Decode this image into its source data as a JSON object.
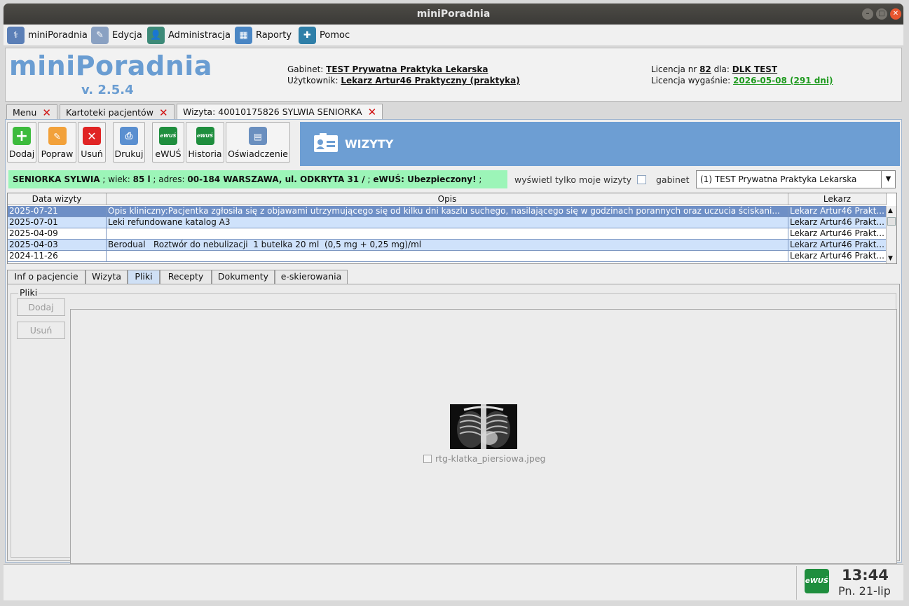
{
  "window": {
    "title": "miniPoradnia"
  },
  "menu": [
    {
      "label": "miniPoradnia",
      "icon": "doctor-icon",
      "color": "#5b7fb7"
    },
    {
      "label": "Edycja",
      "icon": "edit-icon",
      "color": "#8aa1c2"
    },
    {
      "label": "Administracja",
      "icon": "admin-user-icon",
      "color": "#3d8a78"
    },
    {
      "label": "Raporty",
      "icon": "report-icon",
      "color": "#4a86c4"
    },
    {
      "label": "Pomoc",
      "icon": "help-lifebuoy-icon",
      "color": "#2f7fa8"
    }
  ],
  "header": {
    "logo": "miniPoradnia",
    "version": "v. 2.5.4",
    "gabinet_label": "Gabinet:",
    "gabinet_value": "TEST Prywatna Praktyka Lekarska",
    "user_label": "Użytkownik:",
    "user_value": "Lekarz Artur46 Praktyczny (praktyka)",
    "license_label": "Licencja nr",
    "license_nr": "82",
    "license_for": "dla:",
    "license_owner": "DLK TEST",
    "expiry_label": "Licencja wygaśnie:",
    "expiry_value": "2026-05-08 (291 dni)"
  },
  "doc_tabs": [
    {
      "label": "Menu"
    },
    {
      "label": "Kartoteki pacjentów"
    },
    {
      "label": "Wizyta: 40010175826 SYLWIA SENIORKA"
    }
  ],
  "toolbar": {
    "add": "Dodaj",
    "edit": "Popraw",
    "delete": "Usuń",
    "print": "Drukuj",
    "ewus": "eWUŚ",
    "history": "Historia",
    "statement": "Oświadczenie",
    "ewus_badge": "eWUŚ",
    "banner_title": "WIZYTY"
  },
  "patient": {
    "name": "SENIORKA SYLWIA",
    "sep1": " ; wiek: ",
    "age": "85 l",
    "sep2": " ; adres: ",
    "address": "00-184 WARSZAWA, ul. ODKRYTA 31 /",
    "sep3": " ; ",
    "ewus": "eWUŚ: Ubezpieczony!",
    "sep4": " ;"
  },
  "filter": {
    "only_mine_label": "wyświetl tylko moje wizyty",
    "gabinet_label": "gabinet",
    "gabinet_selected": "(1) TEST Prywatna Praktyka Lekarska"
  },
  "visits": {
    "columns": [
      "Data wizyty",
      "Opis",
      "Lekarz"
    ],
    "rows": [
      {
        "date": "2025-07-21",
        "desc": "Opis kliniczny:Pacjentka zgłosiła się z objawami utrzymującego się od kilku dni kaszlu suchego, nasilającego się w godzinach porannych oraz uczucia ściskani...",
        "doctor": "Lekarz Artur46 Prakt..."
      },
      {
        "date": "2025-07-01",
        "desc": "Leki refundowane katalog A3",
        "doctor": "Lekarz Artur46 Prakt..."
      },
      {
        "date": "2025-04-09",
        "desc": "",
        "doctor": "Lekarz Artur46 Prakt..."
      },
      {
        "date": "2025-04-03",
        "desc": "Berodual   Roztwór do nebulizacji  1 butelka 20 ml  (0,5 mg + 0,25 mg)/ml",
        "doctor": "Lekarz Artur46 Prakt..."
      },
      {
        "date": "2024-11-26",
        "desc": "",
        "doctor": "Lekarz Artur46 Prakt..."
      }
    ]
  },
  "subtabs": [
    "Inf o pacjencie",
    "Wizyta",
    "Pliki",
    "Recepty",
    "Dokumenty",
    "e-skierowania"
  ],
  "files": {
    "group_label": "Pliki",
    "add": "Dodaj",
    "delete": "Usuń",
    "items": [
      {
        "name": "rtg-klatka_piersiowa.jpeg"
      }
    ]
  },
  "status": {
    "ewus_badge": "eWUŚ",
    "time": "13:44",
    "date": "Pn. 21-lip"
  }
}
